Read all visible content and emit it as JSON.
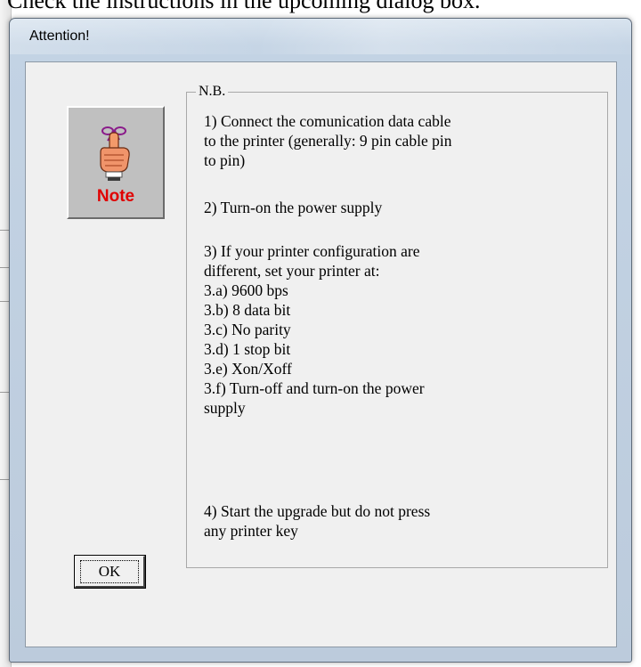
{
  "background": {
    "instruction_text": "Check the instructions in the upcoming dialog box."
  },
  "dialog": {
    "title": "Attention!",
    "note_icon_label": "Note",
    "group_label": "N.B.",
    "paragraphs": [
      "1) Connect the comunication data cable\nto the printer (generally: 9 pin cable pin\nto pin)",
      "2) Turn-on the power supply",
      "3) If your printer configuration are\ndifferent, set your printer at:\n3.a) 9600 bps\n3.b) 8 data bit\n3.c) No parity\n3.d) 1 stop bit\n3.e) Xon/Xoff\n3.f) Turn-off and turn-on the power\nsupply",
      "4) Start the upgrade but do not press\nany printer key"
    ],
    "ok_label": "OK"
  },
  "colors": {
    "note_red": "#e00000",
    "dialog_face": "#f0f0f0",
    "frame": "#bccbdc"
  }
}
